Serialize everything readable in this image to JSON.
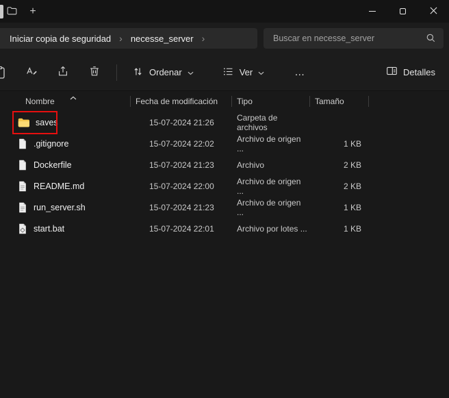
{
  "titlebar": {
    "new_tab": "+"
  },
  "breadcrumb": {
    "items": [
      "Iniciar copia de seguridad",
      "necesse_server"
    ]
  },
  "search": {
    "placeholder": "Buscar en necesse_server"
  },
  "toolbar": {
    "sort": "Ordenar",
    "view": "Ver",
    "more": "…",
    "details": "Detalles"
  },
  "icons": {
    "chevron_right": "›"
  },
  "columns": {
    "name": "Nombre",
    "date": "Fecha de modificación",
    "type": "Tipo",
    "size": "Tamaño"
  },
  "files": [
    {
      "name": "saves",
      "date": "15-07-2024 21:26",
      "type": "Carpeta de archivos",
      "size": "",
      "icon": "folder-icon",
      "highlighted": true
    },
    {
      "name": ".gitignore",
      "date": "15-07-2024 22:02",
      "type": "Archivo de origen ...",
      "size": "1 KB",
      "icon": "file-icon"
    },
    {
      "name": "Dockerfile",
      "date": "15-07-2024 21:23",
      "type": "Archivo",
      "size": "2 KB",
      "icon": "file-icon"
    },
    {
      "name": "README.md",
      "date": "15-07-2024 22:00",
      "type": "Archivo de origen ...",
      "size": "2 KB",
      "icon": "text-file-icon"
    },
    {
      "name": "run_server.sh",
      "date": "15-07-2024 21:23",
      "type": "Archivo de origen ...",
      "size": "1 KB",
      "icon": "script-file-icon"
    },
    {
      "name": "start.bat",
      "date": "15-07-2024 22:01",
      "type": "Archivo por lotes ...",
      "size": "1 KB",
      "icon": "batch-file-icon"
    }
  ],
  "colors": {
    "highlight_red": "#e60f0f",
    "folder_yellow": "#f3c74f",
    "chrome_bg": "#1c1c1c",
    "list_bg": "#191919"
  }
}
